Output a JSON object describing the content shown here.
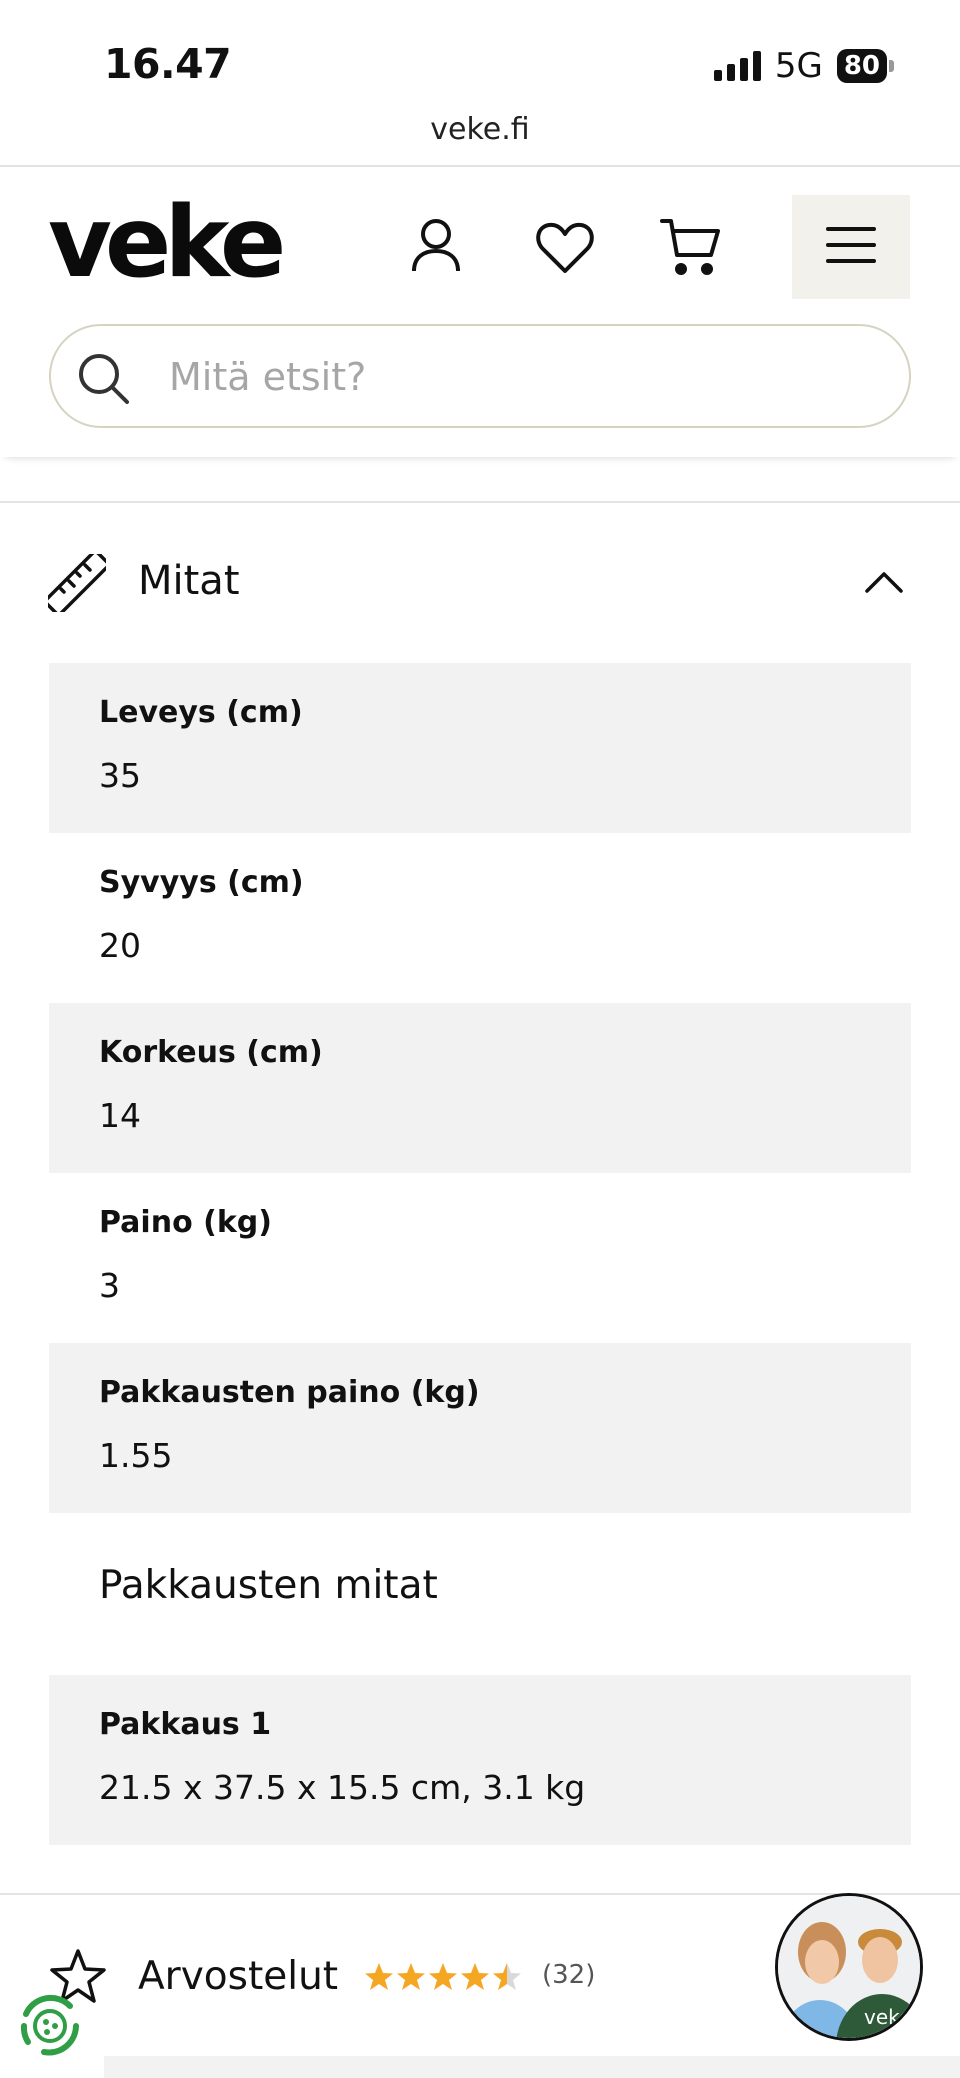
{
  "status_bar": {
    "time": "16.47",
    "network": "5G",
    "battery": "80"
  },
  "browser": {
    "url": "veke.fi"
  },
  "header": {
    "logo": "veke",
    "search": {
      "placeholder": "Mitä etsit?"
    }
  },
  "dimensions_section": {
    "title": "Mitat",
    "specs": [
      {
        "label": "Leveys (cm)",
        "value": "35"
      },
      {
        "label": "Syvyys (cm)",
        "value": "20"
      },
      {
        "label": "Korkeus (cm)",
        "value": "14"
      },
      {
        "label": "Paino (kg)",
        "value": "3"
      },
      {
        "label": "Pakkausten paino (kg)",
        "value": "1.55"
      }
    ],
    "packages_heading": "Pakkausten mitat",
    "packages": [
      {
        "label": "Pakkaus 1",
        "value": "21.5 x 37.5 x 15.5 cm, 3.1 kg"
      }
    ]
  },
  "reviews_section": {
    "title": "Arvostelut",
    "rating": 4.5,
    "count": "(32)",
    "star_color": "#f5a623"
  },
  "chat_avatar": {
    "badge_text": "veke"
  },
  "icons": [
    "user-icon",
    "heart-icon",
    "cart-icon",
    "menu-icon",
    "search-icon",
    "ruler-icon",
    "chevron-up-icon",
    "star-outline-icon",
    "eco-badge-icon"
  ],
  "colors": {
    "header_button_bg": "#f2f1ec",
    "search_border": "#d6d3c2",
    "row_shade": "#f2f2f2",
    "eco_green": "#2f9e44"
  }
}
